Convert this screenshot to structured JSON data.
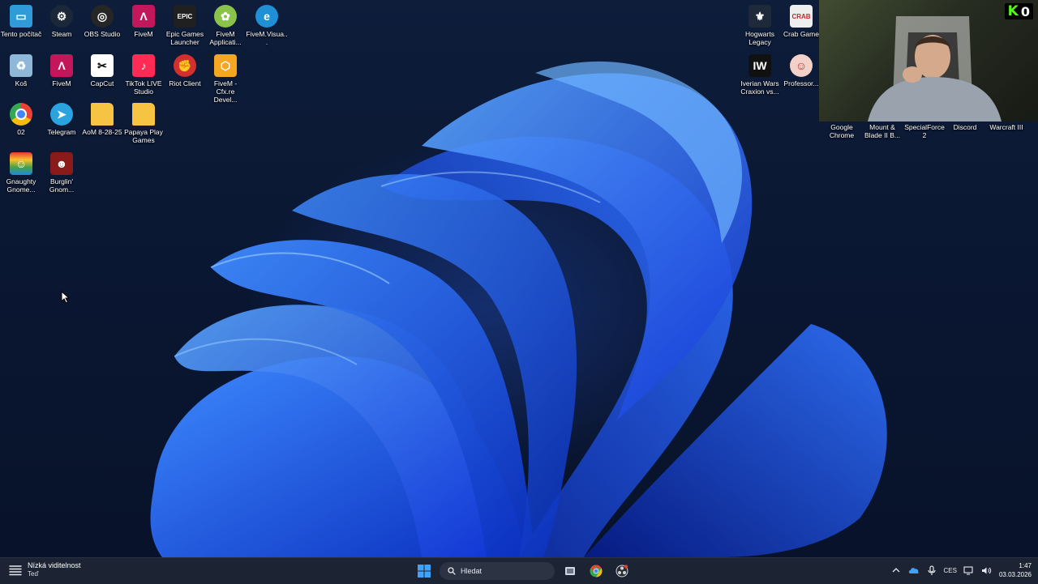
{
  "desktop": {
    "left_icons": [
      {
        "label": "Tento počítač",
        "icon": "monitor-icon",
        "color": "#2f9bd8"
      },
      {
        "label": "Steam",
        "icon": "steam-icon",
        "color": "#1b2838"
      },
      {
        "label": "OBS Studio",
        "icon": "obs-icon",
        "color": "#262626"
      },
      {
        "label": "FiveM",
        "icon": "fivem-icon",
        "color": "#c2185b"
      },
      {
        "label": "Epic Games Launcher",
        "icon": "epic-games-icon",
        "color": "#202020"
      },
      {
        "label": "FiveM Applicati...",
        "icon": "fivem-app-icon",
        "color": "#8bc34a"
      },
      {
        "label": "FiveM.Visua...",
        "icon": "edge-icon",
        "color": "#1f8fd6"
      },
      {
        "label": "Koš",
        "icon": "recycle-bin-icon",
        "color": "#8fb8d8"
      },
      {
        "label": "FiveM",
        "icon": "fivem-icon",
        "color": "#c2185b"
      },
      {
        "label": "CapCut",
        "icon": "capcut-icon",
        "color": "#ffffff"
      },
      {
        "label": "TikTok LIVE Studio",
        "icon": "tiktok-icon",
        "color": "#fe2c55"
      },
      {
        "label": "Riot Client",
        "icon": "riot-icon",
        "color": "#d32f2f"
      },
      {
        "label": "FiveM - Cfx.re Devel...",
        "icon": "cfx-icon",
        "color": "#f5a623"
      },
      {
        "label": "02",
        "icon": "chrome-icon",
        "color": "#4285f4"
      },
      {
        "label": "Telegram",
        "icon": "telegram-icon",
        "color": "#2aa3df"
      },
      {
        "label": "AoM 8-28-25",
        "icon": "folder-icon",
        "color": "#f6c343"
      },
      {
        "label": "Papaya Play Games",
        "icon": "folder-icon",
        "color": "#f6c343"
      },
      {
        "label": "Gnaughty Gnome...",
        "icon": "gnome-game-icon",
        "color": "#c37b3a"
      },
      {
        "label": "Burglin' Gnom...",
        "icon": "burglin-gnomes-icon",
        "color": "#8b1a1a"
      }
    ],
    "right_icons": [
      {
        "label": "Hogwarts Legacy",
        "icon": "hogwarts-icon",
        "color": "#1e2a3a"
      },
      {
        "label": "Crab Game",
        "icon": "crab-game-icon",
        "color": "#eeeeee"
      },
      {
        "label": "Iverian Wars Craxion vs...",
        "icon": "iverian-wars-icon",
        "color": "#111111"
      },
      {
        "label": "Professor...",
        "icon": "professor-icon",
        "color": "#f4d1c8"
      },
      {
        "label": "Google Chrome",
        "icon": "chrome-icon",
        "color": "#4285f4"
      },
      {
        "label": "Mount & Blade II B...",
        "icon": "mount-blade-icon",
        "color": "#5a3d1e"
      },
      {
        "label": "SpecialForce2",
        "icon": "specialforce-icon",
        "color": "#2d4a2b"
      },
      {
        "label": "Discord",
        "icon": "discord-icon",
        "color": "#5865f2"
      },
      {
        "label": "Warcraft III",
        "icon": "warcraft-icon",
        "color": "#7a2a10"
      }
    ]
  },
  "webcam": {
    "kick_logo": "K",
    "kick_count": "0",
    "accent": "#53fc18"
  },
  "taskbar": {
    "widget_title": "Nízká viditelnost",
    "widget_sub": "Teď",
    "search_placeholder": "Hledat",
    "language": "CES",
    "time": "1:47",
    "date": "03.03.2026"
  }
}
